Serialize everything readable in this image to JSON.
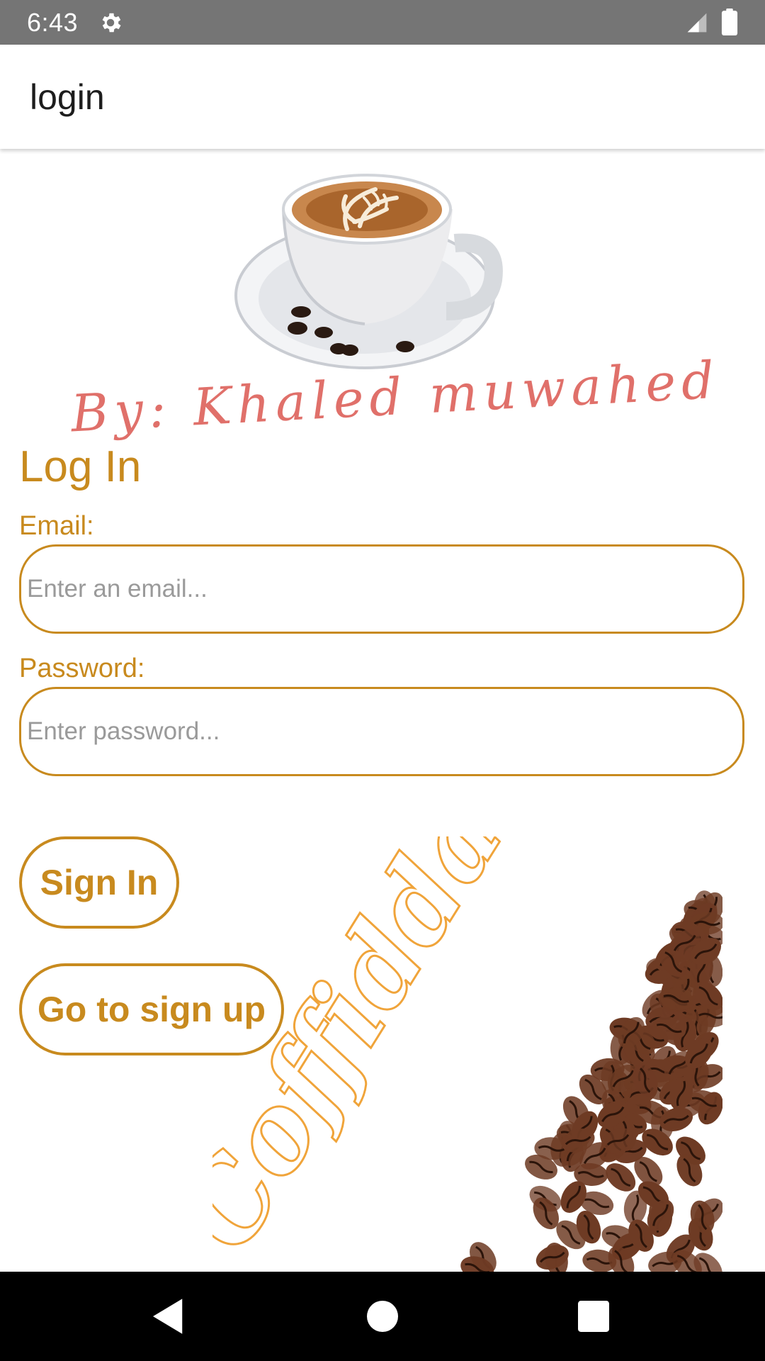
{
  "status_bar": {
    "time": "6:43",
    "icons": [
      "gear-icon",
      "signal-icon",
      "battery-icon"
    ]
  },
  "app_bar": {
    "title": "login"
  },
  "logo": {
    "icon": "coffee-cup-icon",
    "byline": "By: Khaled muwahed"
  },
  "form": {
    "heading": "Log In",
    "email_label": "Email:",
    "email_placeholder": "Enter an email...",
    "email_value": "",
    "password_label": "Password:",
    "password_placeholder": "Enter password...",
    "password_value": "",
    "sign_in_label": "Sign In",
    "go_to_signup_label": "Go to sign up"
  },
  "decor": {
    "wordmark": "Coffidda",
    "icon": "coffee-beans-icon"
  },
  "nav_bar": {
    "icons": [
      "back-icon",
      "home-icon",
      "recents-icon"
    ]
  },
  "colors": {
    "accent": "#c88a1e",
    "status_bar": "#757575",
    "byline": "#e0706a",
    "wordmark": "#f0a43a",
    "bean": "#6e3b24"
  }
}
